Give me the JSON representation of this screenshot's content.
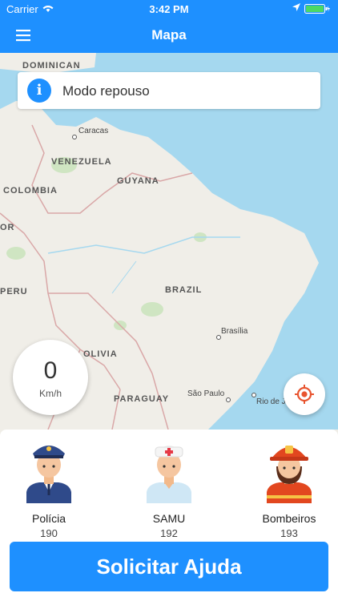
{
  "status_bar": {
    "carrier": "Carrier",
    "time": "3:42 PM"
  },
  "header": {
    "title": "Mapa"
  },
  "banner": {
    "text": "Modo repouso"
  },
  "map": {
    "countries": [
      "DOMINICAN",
      "VENEZUELA",
      "GUYANA",
      "COLOMBIA",
      "BRAZIL",
      "OLIVIA",
      "PARAGUAY",
      "OR",
      "PERU"
    ],
    "cities": [
      "Caracas",
      "Brasília",
      "São Paulo",
      "Rio de J"
    ]
  },
  "speed": {
    "value": "0",
    "unit": "Km/h"
  },
  "services": [
    {
      "label": "Polícia",
      "number": "190"
    },
    {
      "label": "SAMU",
      "number": "192"
    },
    {
      "label": "Bombeiros",
      "number": "193"
    }
  ],
  "cta": {
    "label": "Solicitar Ajuda"
  },
  "colors": {
    "primary": "#1e90ff",
    "water": "#a5d8ef",
    "land": "#f0eee8"
  }
}
